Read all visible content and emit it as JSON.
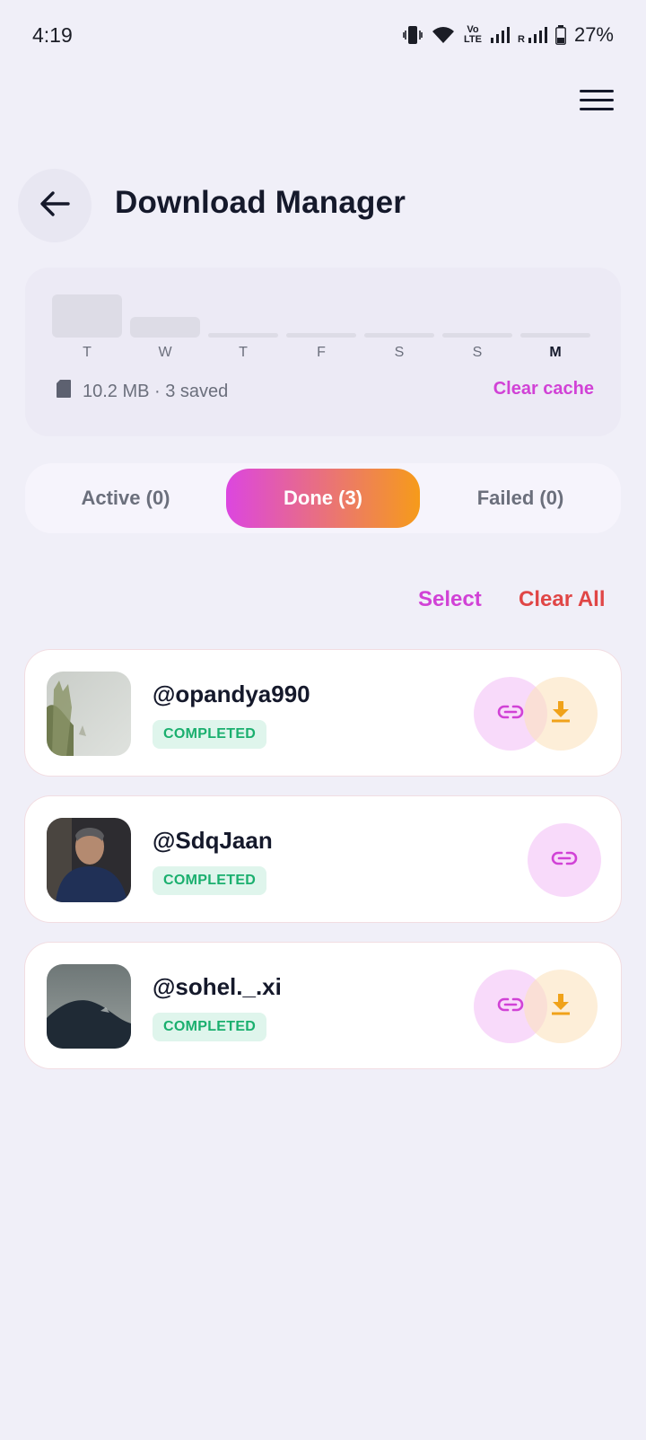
{
  "status_bar": {
    "time": "4:19",
    "battery": "27%",
    "volte_top": "Vo",
    "volte_bottom": "LTE",
    "roaming": "R"
  },
  "header": {
    "title": "Download Manager",
    "back_icon": "arrow-left-icon",
    "menu_icon": "hamburger-menu-icon"
  },
  "stats": {
    "days": [
      "T",
      "W",
      "T",
      "F",
      "S",
      "S",
      "M"
    ],
    "active_day": "M",
    "day_activity": [
      1.0,
      0.48,
      0.0,
      0.0,
      0.0,
      0.0,
      0.0
    ],
    "storage_text": "10.2 MB · 3 saved",
    "clear_cache_label": "Clear cache"
  },
  "tabs": [
    {
      "label": "Active (0)",
      "selected": false
    },
    {
      "label": "Done (3)",
      "selected": true
    },
    {
      "label": "Failed (0)",
      "selected": false
    }
  ],
  "actions": {
    "select_label": "Select",
    "clear_all_label": "Clear All"
  },
  "downloads": [
    {
      "username": "@opandya990",
      "status": "COMPLETED",
      "has_download": true
    },
    {
      "username": "@SdqJaan",
      "status": "COMPLETED",
      "has_download": false
    },
    {
      "username": "@sohel._.xi",
      "status": "COMPLETED",
      "has_download": true
    }
  ],
  "colors": {
    "accent_pink": "#d142d6",
    "accent_orange": "#f69b1a",
    "danger": "#e04646",
    "success": "#1aaf6e",
    "background": "#f0eff8"
  }
}
